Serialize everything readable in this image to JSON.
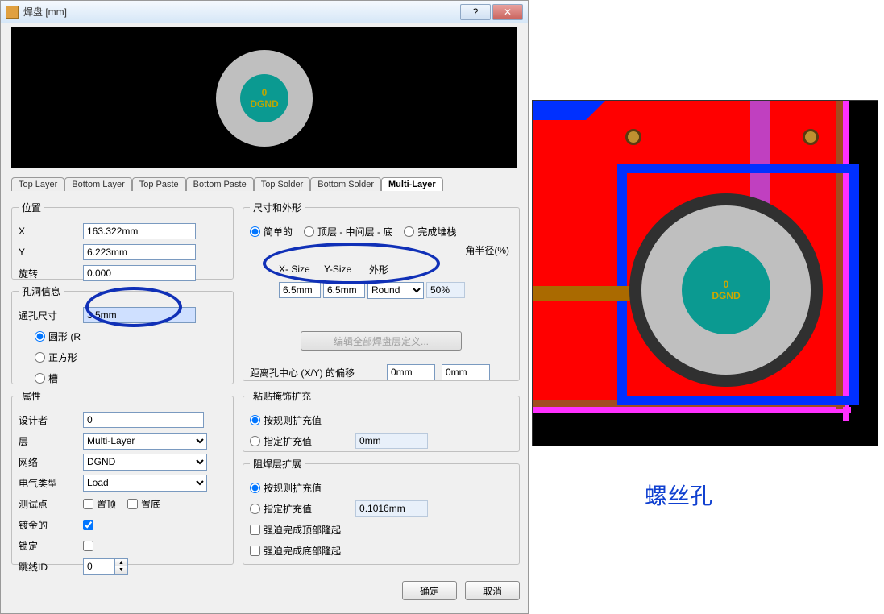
{
  "window": {
    "title": "焊盘 [mm]"
  },
  "preview": {
    "designator": "0",
    "net": "DGND"
  },
  "tabs": [
    {
      "label": "Top Layer"
    },
    {
      "label": "Bottom Layer"
    },
    {
      "label": "Top Paste"
    },
    {
      "label": "Bottom Paste"
    },
    {
      "label": "Top Solder"
    },
    {
      "label": "Bottom Solder"
    },
    {
      "label": "Multi-Layer"
    }
  ],
  "active_tab": "Multi-Layer",
  "position": {
    "legend": "位置",
    "x_label": "X",
    "x_value": "163.322mm",
    "y_label": "Y",
    "y_value": "6.223mm",
    "rot_label": "旋转",
    "rot_value": "0.000"
  },
  "hole": {
    "legend": "孔洞信息",
    "size_label": "通孔尺寸",
    "size_value": "3.5mm",
    "shape_round": "圆形 (R",
    "shape_square": "正方形",
    "shape_slot": "槽"
  },
  "attrs": {
    "legend": "属性",
    "designer_label": "设计者",
    "designer_value": "0",
    "layer_label": "层",
    "layer_value": "Multi-Layer",
    "net_label": "网络",
    "net_value": "DGND",
    "elec_label": "电气类型",
    "elec_value": "Load",
    "testpt_label": "测试点",
    "testpt_top": "置顶",
    "testpt_bot": "置底",
    "plated_label": "镀金的",
    "locked_label": "锁定",
    "jumper_label": "跳线ID",
    "jumper_value": "0"
  },
  "size": {
    "legend": "尺寸和外形",
    "simple": "简单的",
    "tml": "顶层 - 中间层 - 底",
    "full": "完成堆栈",
    "corner_label": "角半径(%)",
    "xsize_h": "X- Size",
    "ysize_h": "Y-Size",
    "shape_h": "外形",
    "xsize": "6.5mm",
    "ysize": "6.5mm",
    "shape": "Round",
    "corner": "50%",
    "edit_all": "编辑全部焊盘层定义...",
    "offset_label": "距离孔中心 (X/Y) 的偏移",
    "offset_x": "0mm",
    "offset_y": "0mm"
  },
  "paste": {
    "legend": "粘贴掩饰扩充",
    "by_rule": "按规则扩充值",
    "specify": "指定扩充值",
    "value": "0mm"
  },
  "mask": {
    "legend": "阻焊层扩展",
    "by_rule": "按规则扩充值",
    "specify": "指定扩充值",
    "value": "0.1016mm",
    "force_top": "强迫完成顶部隆起",
    "force_bot": "强迫完成底部隆起"
  },
  "buttons": {
    "ok": "确定",
    "cancel": "取消"
  },
  "caption": "螺丝孔",
  "pcb_preview": {
    "designator": "0",
    "net": "DGND"
  }
}
